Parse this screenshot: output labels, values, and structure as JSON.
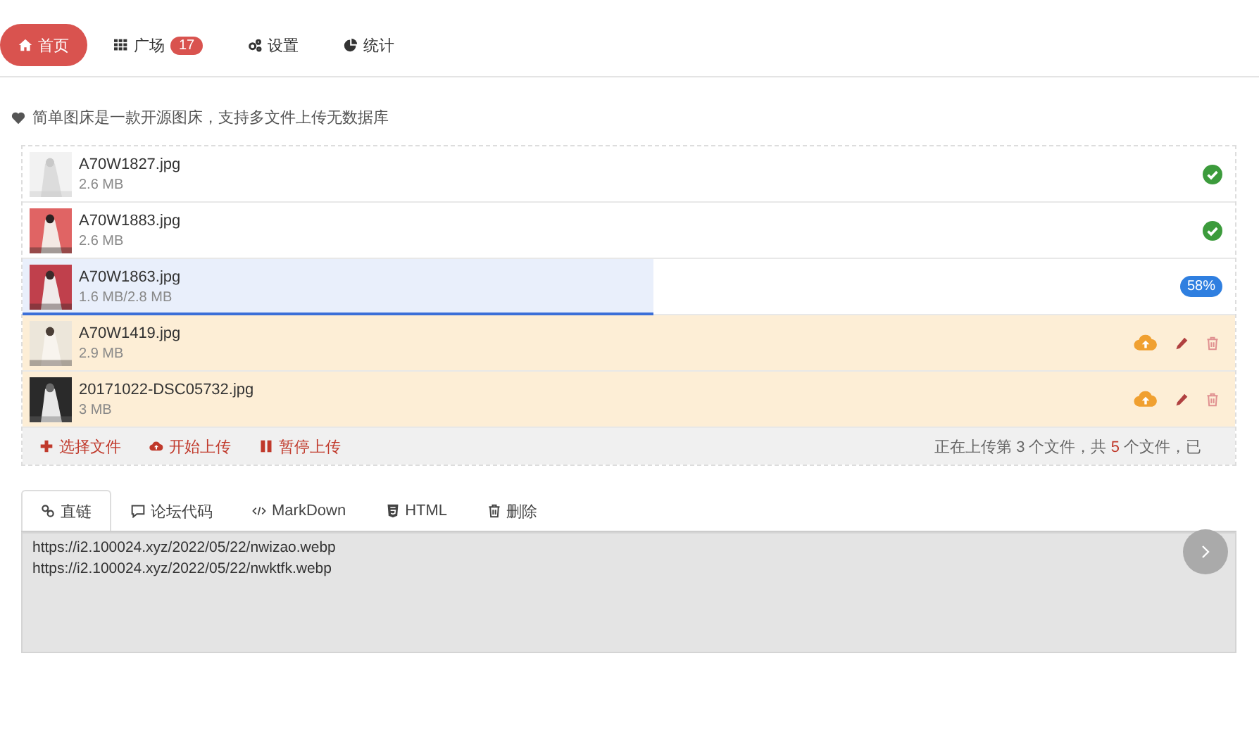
{
  "nav": [
    {
      "label": "首页",
      "kind": "home",
      "selected": true
    },
    {
      "label": "广场",
      "kind": "grid",
      "badge": "17",
      "selected": false
    },
    {
      "label": "设置",
      "kind": "gears",
      "selected": false
    },
    {
      "label": "统计",
      "kind": "pie",
      "selected": false
    }
  ],
  "notice": "简单图床是一款开源图床，支持多文件上传无数据库",
  "files": [
    {
      "name": "A70W1827.jpg",
      "size": "2.6 MB",
      "kind": "done"
    },
    {
      "name": "A70W1883.jpg",
      "size": "2.6 MB",
      "kind": "done"
    },
    {
      "name": "A70W1863.jpg",
      "size": "1.6 MB/2.8 MB",
      "kind": "uploading",
      "level": 0.52,
      "percent": "58%"
    },
    {
      "name": "A70W1419.jpg",
      "size": "2.9 MB",
      "kind": "queued"
    },
    {
      "name": "20171022-DSC05732.jpg",
      "size": "3 MB",
      "kind": "queued"
    }
  ],
  "actions": [
    {
      "label": "选择文件",
      "kind": "plus"
    },
    {
      "label": "开始上传",
      "kind": "cloud"
    },
    {
      "label": "暂停上传",
      "kind": "pause"
    }
  ],
  "status": [
    {
      "text": "正在上传第 3 个文件，共 ",
      "highlight": false
    },
    {
      "text": "5",
      "highlight": true
    },
    {
      "text": " 个文件，已",
      "highlight": false
    }
  ],
  "result_tabs": [
    {
      "label": "直链",
      "kind": "link",
      "selected": true
    },
    {
      "label": "论坛代码",
      "kind": "comment",
      "selected": false
    },
    {
      "label": "MarkDown",
      "kind": "code",
      "selected": false
    },
    {
      "label": "HTML",
      "kind": "html",
      "selected": false
    },
    {
      "label": "删除",
      "kind": "trash",
      "selected": false
    }
  ],
  "links": [
    "https://i2.100024.xyz/2022/05/22/nwizao.webp",
    "https://i2.100024.xyz/2022/05/22/nwktfk.webp"
  ]
}
